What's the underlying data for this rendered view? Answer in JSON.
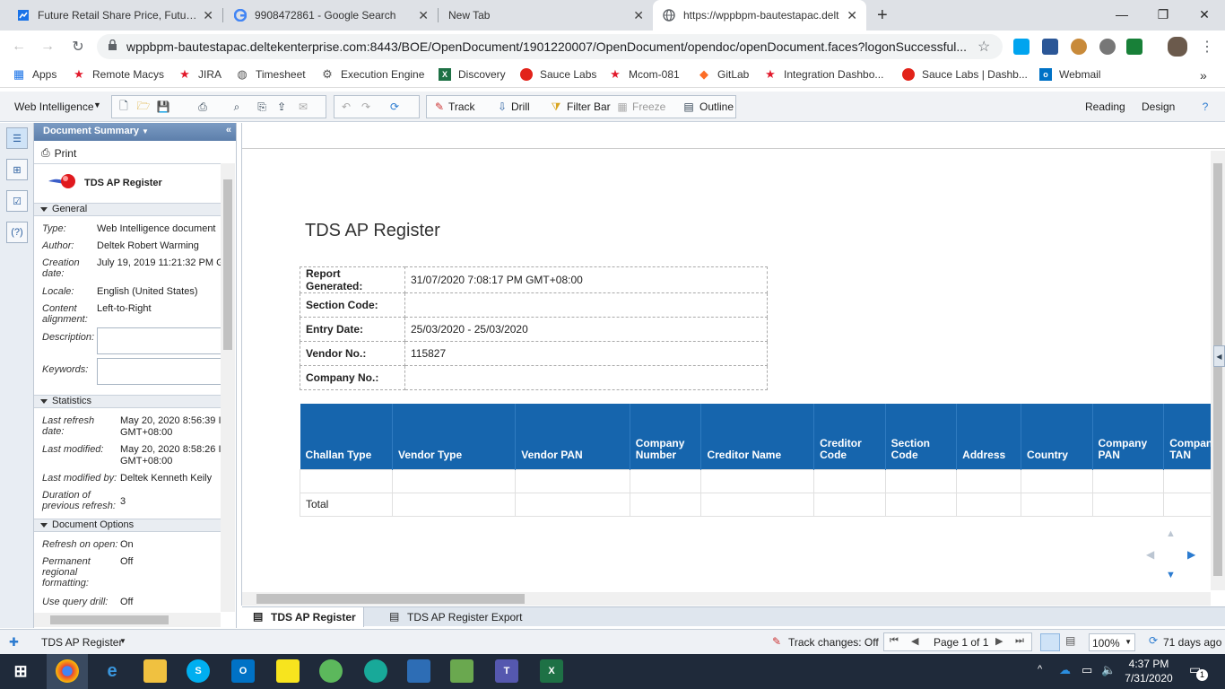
{
  "browser": {
    "tabs": [
      {
        "title": "Future Retail Share Price, Future R",
        "icon": "chart-icon"
      },
      {
        "title": "9908472861 - Google Search",
        "icon": "google-icon"
      },
      {
        "title": "New Tab",
        "icon": ""
      },
      {
        "title": "https://wppbpm-bautestapac.delt",
        "icon": "globe-icon"
      }
    ],
    "address": "wppbpm-bautestapac.deltekenterprise.com:8443/BOE/OpenDocument/1901220007/OpenDocument/opendoc/openDocument.faces?logonSuccessful...",
    "bookmarks": [
      {
        "label": "Apps",
        "icon": "apps-grid-icon"
      },
      {
        "label": "Remote Macys",
        "icon": "star-icon"
      },
      {
        "label": "JIRA",
        "icon": "star-icon"
      },
      {
        "label": "Timesheet",
        "icon": "globe-icon"
      },
      {
        "label": "Execution Engine",
        "icon": "gear-icon"
      },
      {
        "label": "Discovery",
        "icon": "excel-icon"
      },
      {
        "label": "Sauce Labs",
        "icon": "sauce-icon"
      },
      {
        "label": "Mcom-081",
        "icon": "star-icon"
      },
      {
        "label": "GitLab",
        "icon": "gitlab-icon"
      },
      {
        "label": "Integration Dashbo...",
        "icon": "star-icon"
      },
      {
        "label": "Sauce Labs | Dashb...",
        "icon": "sauce-icon"
      },
      {
        "label": "Webmail",
        "icon": "outlook-icon"
      }
    ],
    "overflow": "»"
  },
  "toolbar": {
    "app_menu": "Web Intelligence",
    "track": "Track",
    "drill": "Drill",
    "filter_bar": "Filter Bar",
    "freeze": "Freeze",
    "outline": "Outline",
    "reading": "Reading",
    "design": "Design"
  },
  "panel": {
    "title": "Document Summary",
    "print": "Print",
    "doc_name": "TDS AP Register",
    "general": "General",
    "type_label": "Type:",
    "type": "Web Intelligence document",
    "author_label": "Author:",
    "author": "Deltek Robert Warming",
    "creation_label": "Creation date:",
    "creation": "July 19, 2019 11:21:32 PM G",
    "locale_label": "Locale:",
    "locale": "English (United States)",
    "align_label": "Content alignment:",
    "align": "Left-to-Right",
    "desc_label": "Description:",
    "keywords_label": "Keywords:",
    "statistics": "Statistics",
    "refresh_label": "Last refresh date:",
    "refresh": "May 20, 2020 8:56:39 I",
    "refresh_tz": "GMT+08:00",
    "modified_label": "Last modified:",
    "modified": "May 20, 2020 8:58:26 I",
    "modified_tz": "GMT+08:00",
    "modified_by_label": "Last modified by:",
    "modified_by": "Deltek Kenneth Keily",
    "duration_label": "Duration of previous refresh:",
    "duration": "3",
    "doc_options": "Document Options",
    "refresh_open_label": "Refresh on open:",
    "refresh_open": "On",
    "perm_label": "Permanent regional formatting:",
    "perm": "Off",
    "query_drill_label": "Use query drill:",
    "query_drill": "Off"
  },
  "report": {
    "title": "TDS AP Register",
    "filters": [
      {
        "key": "Report Generated:",
        "value": "31/07/2020 7:08:17 PM GMT+08:00"
      },
      {
        "key": "Section Code:",
        "value": ""
      },
      {
        "key": "Entry Date:",
        "value": "25/03/2020 - 25/03/2020"
      },
      {
        "key": "Vendor No.:",
        "value": "115827"
      },
      {
        "key": "Company No.:",
        "value": ""
      }
    ],
    "columns": [
      "Challan Type",
      "Vendor Type",
      "Vendor PAN",
      "Company Number",
      "Creditor Name",
      "Creditor Code",
      "Section Code",
      "Address",
      "Country",
      "Company PAN",
      "Company TAN"
    ],
    "total_label": "Total"
  },
  "report_tabs": [
    "TDS AP Register",
    "TDS AP Register Export"
  ],
  "status": {
    "report_name": "TDS AP Register",
    "track_changes": "Track changes: Off",
    "page": "Page 1 of 1",
    "zoom": "100%",
    "age": "71 days ago"
  },
  "taskbar": {
    "time": "4:37 PM",
    "date": "7/31/2020",
    "notifications": "1"
  }
}
